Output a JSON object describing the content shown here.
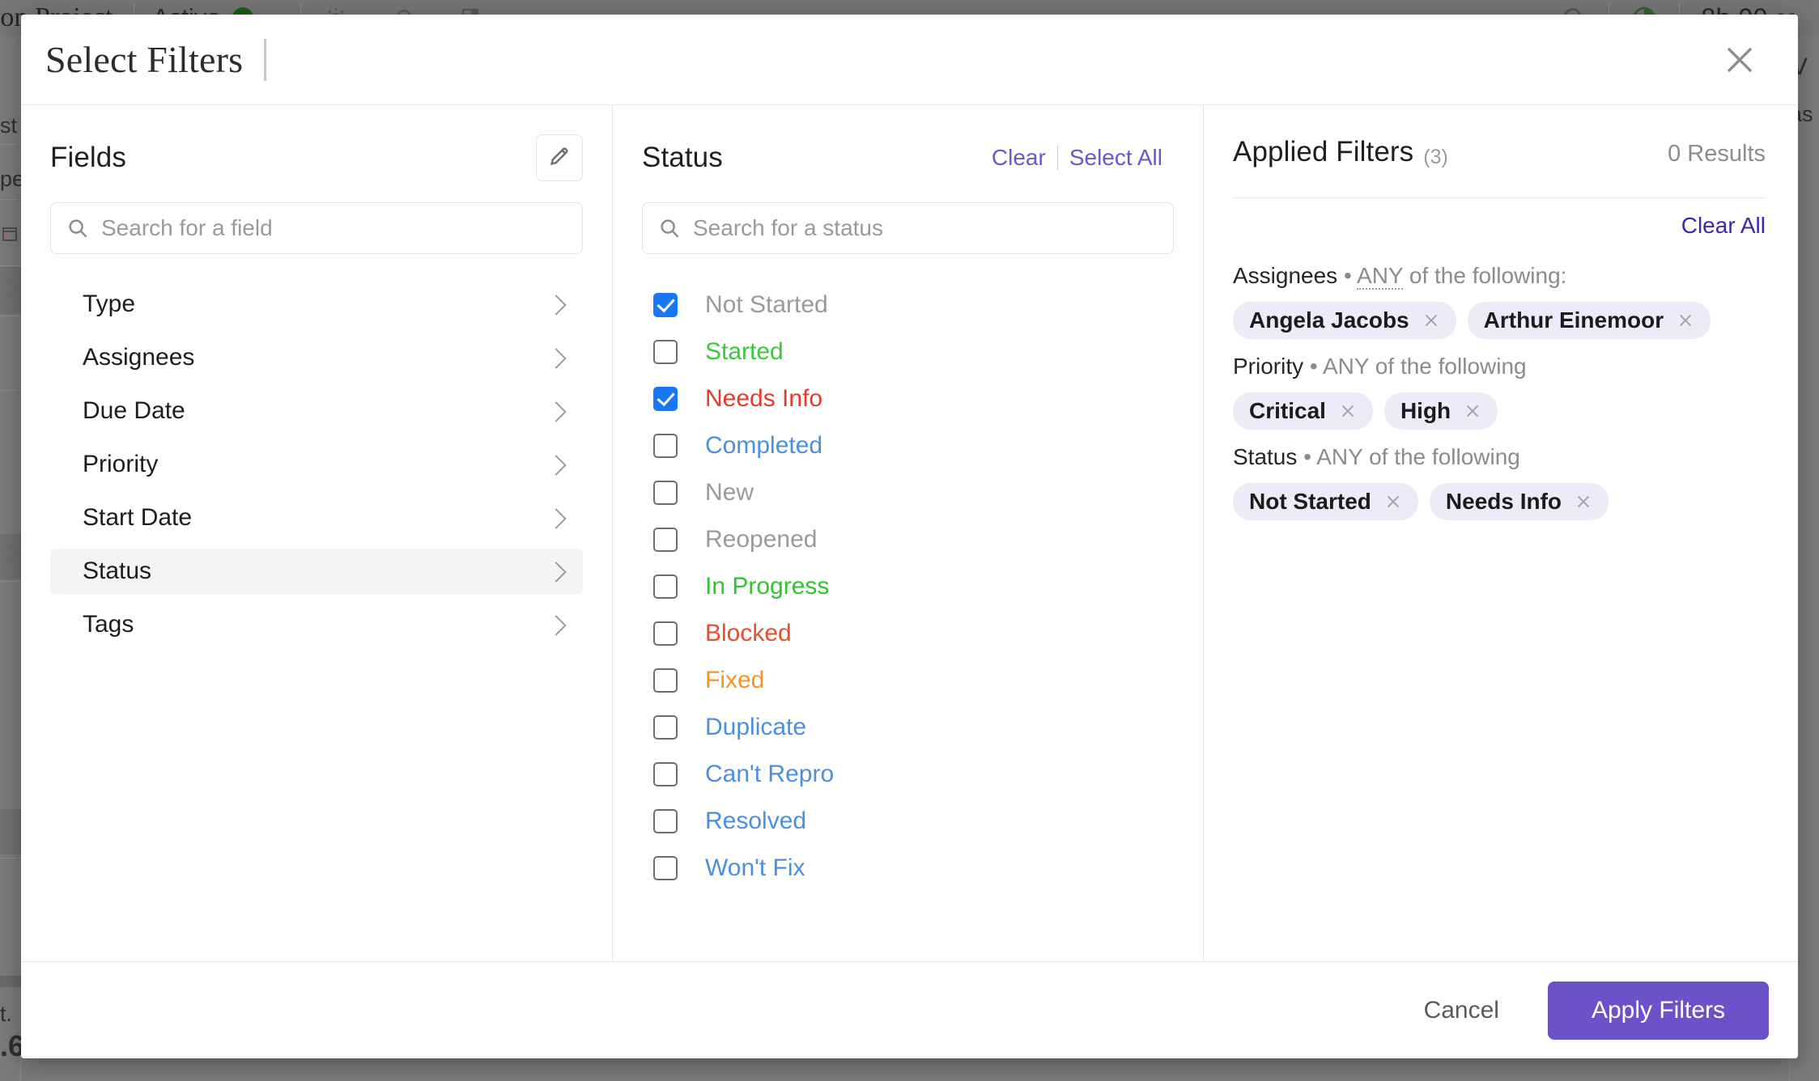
{
  "background": {
    "app_title": "ntation Project",
    "status_label": "Active",
    "status_color": "#14610f",
    "timer_main": "8h 00",
    "timer_secs": "00",
    "icons": [
      "gear-icon",
      "bell-icon",
      "panel-icon",
      "search-icon",
      "pie-timer-icon"
    ],
    "left_fragments": [
      "st",
      "pe",
      "t.",
      ".6"
    ],
    "right_fragments": [
      "V",
      "as"
    ]
  },
  "modal": {
    "title": "Select Filters",
    "close_icon": "close-icon"
  },
  "fields": {
    "title": "Fields",
    "edit_icon": "pencil-icon",
    "search": {
      "placeholder": "Search for a field",
      "value": ""
    },
    "items": [
      {
        "label": "Type",
        "active": false
      },
      {
        "label": "Assignees",
        "active": false
      },
      {
        "label": "Due Date",
        "active": false
      },
      {
        "label": "Priority",
        "active": false
      },
      {
        "label": "Start Date",
        "active": false
      },
      {
        "label": "Status",
        "active": true
      },
      {
        "label": "Tags",
        "active": false
      }
    ]
  },
  "values": {
    "title": "Status",
    "clear_label": "Clear",
    "select_all_label": "Select All",
    "search": {
      "placeholder": "Search for a status",
      "value": ""
    },
    "options": [
      {
        "label": "Not Started",
        "checked": true,
        "color": "#9a9a9a"
      },
      {
        "label": "Started",
        "checked": false,
        "color": "#3bc93b"
      },
      {
        "label": "Needs Info",
        "checked": true,
        "color": "#e53a2a"
      },
      {
        "label": "Completed",
        "checked": false,
        "color": "#4a90e2"
      },
      {
        "label": "New",
        "checked": false,
        "color": "#9a9a9a"
      },
      {
        "label": "Reopened",
        "checked": false,
        "color": "#9a9a9a"
      },
      {
        "label": "In Progress",
        "checked": false,
        "color": "#2ec52e"
      },
      {
        "label": "Blocked",
        "checked": false,
        "color": "#ef4a2e"
      },
      {
        "label": "Fixed",
        "checked": false,
        "color": "#f79321"
      },
      {
        "label": "Duplicate",
        "checked": false,
        "color": "#4a90e2"
      },
      {
        "label": "Can't Repro",
        "checked": false,
        "color": "#4a90e2"
      },
      {
        "label": "Resolved",
        "checked": false,
        "color": "#4a90e2"
      },
      {
        "label": "Won't Fix",
        "checked": false,
        "color": "#4a90e2"
      }
    ]
  },
  "applied": {
    "title": "Applied Filters",
    "count": "(3)",
    "results": "0 Results",
    "clear_all_label": "Clear All",
    "groups": [
      {
        "field": "Assignees",
        "operator": "ANY",
        "operator_suffix": "of the following:",
        "operator_dotted": true,
        "chips": [
          "Angela Jacobs",
          "Arthur Einemoor"
        ]
      },
      {
        "field": "Priority",
        "operator": "ANY",
        "operator_suffix": "of the following",
        "operator_dotted": false,
        "chips": [
          "Critical",
          "High"
        ]
      },
      {
        "field": "Status",
        "operator": "ANY",
        "operator_suffix": "of the following",
        "operator_dotted": false,
        "chips": [
          "Not Started",
          "Needs Info"
        ]
      }
    ]
  },
  "footer": {
    "cancel_label": "Cancel",
    "apply_label": "Apply Filters",
    "apply_color": "#6b52c8"
  }
}
